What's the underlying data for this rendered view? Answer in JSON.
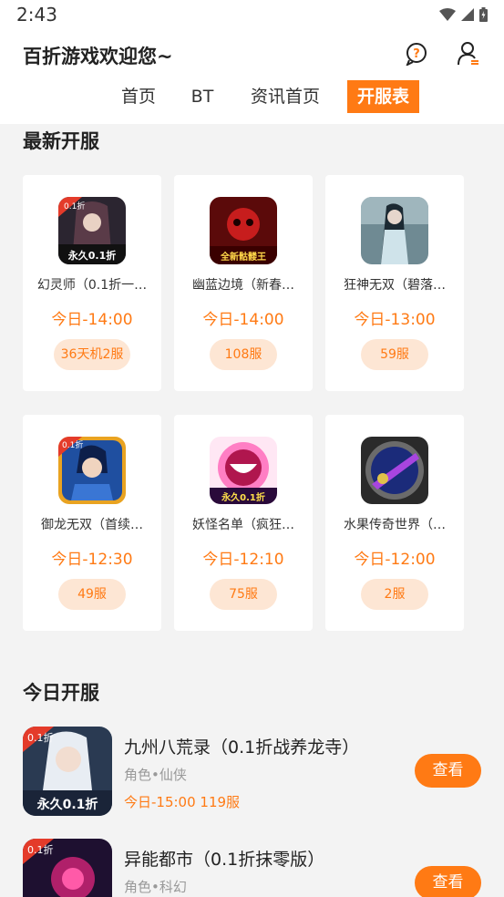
{
  "status": {
    "time": "2:43"
  },
  "header": {
    "title": "百折游戏欢迎您~",
    "icons": [
      "help-chat-icon",
      "user-settings-icon"
    ]
  },
  "tabs": [
    {
      "label": "首页",
      "active": false
    },
    {
      "label": "BT",
      "active": false
    },
    {
      "label": "资讯首页",
      "active": false
    },
    {
      "label": "开服表",
      "active": true
    }
  ],
  "latest": {
    "title": "最新开服",
    "cards": [
      {
        "name": "幻灵师（0.1折一…",
        "time": "今日-14:00",
        "server": "36天机2服",
        "icon_text": "永久0.1折"
      },
      {
        "name": "幽蓝边境（新春…",
        "time": "今日-14:00",
        "server": "108服",
        "icon_text": "全新骷髅王"
      },
      {
        "name": "狂神无双（碧落…",
        "time": "今日-13:00",
        "server": "59服",
        "icon_text": ""
      },
      {
        "name": "御龙无双（首续…",
        "time": "今日-12:30",
        "server": "49服",
        "icon_text": "0.1折"
      },
      {
        "name": "妖怪名单（疯狂…",
        "time": "今日-12:10",
        "server": "75服",
        "icon_text": "永久0.1折"
      },
      {
        "name": "水果传奇世界（…",
        "time": "今日-12:00",
        "server": "2服",
        "icon_text": ""
      }
    ]
  },
  "today": {
    "title": "今日开服",
    "items": [
      {
        "name": "九州八荒录（0.1折战养龙寺）",
        "tags": "角色•仙侠",
        "open": "今日-15:00 119服",
        "button": "查看",
        "icon_text": "永久0.1折"
      },
      {
        "name": "异能都市（0.1折抹零版）",
        "tags": "角色•科幻",
        "open": "",
        "button": "查看",
        "icon_text": "0.1折"
      }
    ]
  },
  "colors": {
    "accent": "#ff7a14",
    "badge_bg": "#fde6d4"
  }
}
